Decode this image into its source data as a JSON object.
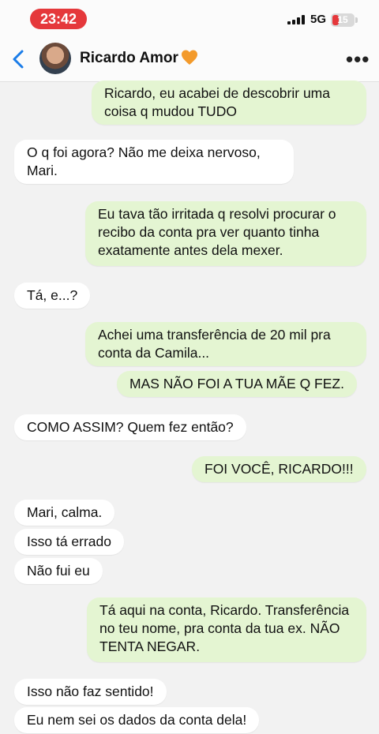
{
  "status_bar": {
    "time": "23:42",
    "network": "5G",
    "battery": "15",
    "accent_color": "#e5383b"
  },
  "header": {
    "contact_name": "Ricardo Amor",
    "heart_emoji": "orange-heart-icon",
    "back_icon": "chevron-left-icon",
    "menu_icon": "more-dots-icon"
  },
  "colors": {
    "incoming_bubble": "#ffffff",
    "outgoing_bubble": "#e4f5d2",
    "background": "#f2f2f2"
  },
  "messages": [
    {
      "direction": "out",
      "text": "Ricardo, eu acabei de descobrir uma coisa q mudou TUDO"
    },
    {
      "direction": "in",
      "text": "O q foi agora? Não me deixa nervoso, Mari."
    },
    {
      "direction": "out",
      "text": "Eu tava tão irritada q resolvi procurar o recibo da conta pra ver quanto tinha exatamente antes dela mexer."
    },
    {
      "direction": "in",
      "text": "Tá, e...?"
    },
    {
      "direction": "out",
      "text": "Achei uma transferência de 20 mil pra conta da Camila..."
    },
    {
      "direction": "out",
      "text": "MAS NÃO FOI A TUA MÃE Q FEZ."
    },
    {
      "direction": "in",
      "text": "COMO ASSIM? Quem fez então?"
    },
    {
      "direction": "out",
      "text": "FOI VOCÊ, RICARDO!!!"
    },
    {
      "direction": "in",
      "text": "Mari, calma."
    },
    {
      "direction": "in",
      "text": "Isso tá errado"
    },
    {
      "direction": "in",
      "text": "Não fui eu"
    },
    {
      "direction": "out",
      "text": "Tá aqui na conta, Ricardo. Transferência no teu nome, pra conta da tua ex. NÃO TENTA NEGAR."
    },
    {
      "direction": "in",
      "text": "Isso não faz sentido!"
    },
    {
      "direction": "in",
      "text": "Eu nem sei os dados da conta dela!"
    }
  ]
}
